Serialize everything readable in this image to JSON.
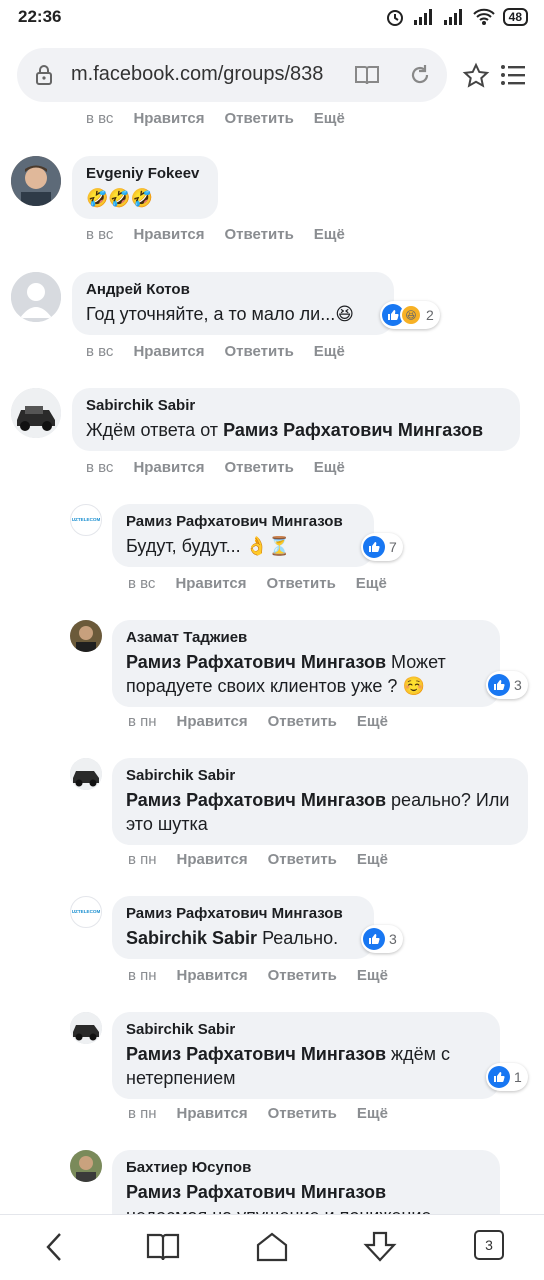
{
  "status": {
    "time": "22:36",
    "battery": "48"
  },
  "browser": {
    "url": "m.facebook.com/groups/838",
    "tabs_count": "3"
  },
  "comments": [
    {
      "name": "",
      "text": "",
      "when": "в вс",
      "like": "Нравится",
      "reply": "Ответить",
      "more": "Ещё"
    },
    {
      "name": "Evgeniy Fokeev",
      "text": "🤣🤣🤣",
      "when": "в вс",
      "like": "Нравится",
      "reply": "Ответить",
      "more": "Ещё"
    },
    {
      "name": "Андрей Котов",
      "text": "Год уточняйте, а то мало ли...😆",
      "when": "в вс",
      "like": "Нравится",
      "reply": "Ответить",
      "more": "Ещё",
      "reactions": "2"
    },
    {
      "name": "Sabirchik Sabir",
      "mention": "Рамиз Рафхатович Мингазов",
      "text": "Ждём ответа от ",
      "when": "в вс",
      "like": "Нравится",
      "reply": "Ответить",
      "more": "Ещё"
    },
    {
      "name": "Рамиз Рафхатович Мингазов",
      "text": "Будут, будут... 👌⏳",
      "when": "в вс",
      "like": "Нравится",
      "reply": "Ответить",
      "more": "Ещё",
      "reactions": "7",
      "avatar_text": "UZTELECOM"
    },
    {
      "name": "Азамат Таджиев",
      "mention": "Рамиз Рафхатович Мингазов",
      "text": " Может порадуете своих клиентов уже ? ☺️",
      "when": "в пн",
      "like": "Нравится",
      "reply": "Ответить",
      "more": "Ещё",
      "reactions": "3"
    },
    {
      "name": "Sabirchik Sabir",
      "mention": "Рамиз Рафхатович Мингазов",
      "text": " реально? Или это шутка",
      "when": "в пн",
      "like": "Нравится",
      "reply": "Ответить",
      "more": "Ещё"
    },
    {
      "name": "Рамиз Рафхатович Мингазов",
      "mention": "Sabirchik Sabir",
      "text": " Реально.",
      "when": "в пн",
      "like": "Нравится",
      "reply": "Ответить",
      "more": "Ещё",
      "reactions": "3",
      "avatar_text": "UZTELECOM"
    },
    {
      "name": "Sabirchik Sabir",
      "mention": "Рамиз Рафхатович Мингазов",
      "text": " ждём с нетерпением",
      "when": "в пн",
      "like": "Нравится",
      "reply": "Ответить",
      "more": "Ещё",
      "reactions": "1"
    },
    {
      "name": "Бахтиер Юсупов",
      "mention": "Рамиз Рафхатович Мингазов",
      "text": "недосмая на упущение и понижение",
      "when": "",
      "like": "",
      "reply": "",
      "more": ""
    }
  ],
  "colors": {
    "bubble": "#f0f2f5",
    "like_blue": "#1877f2",
    "muted": "#8a8d91"
  }
}
